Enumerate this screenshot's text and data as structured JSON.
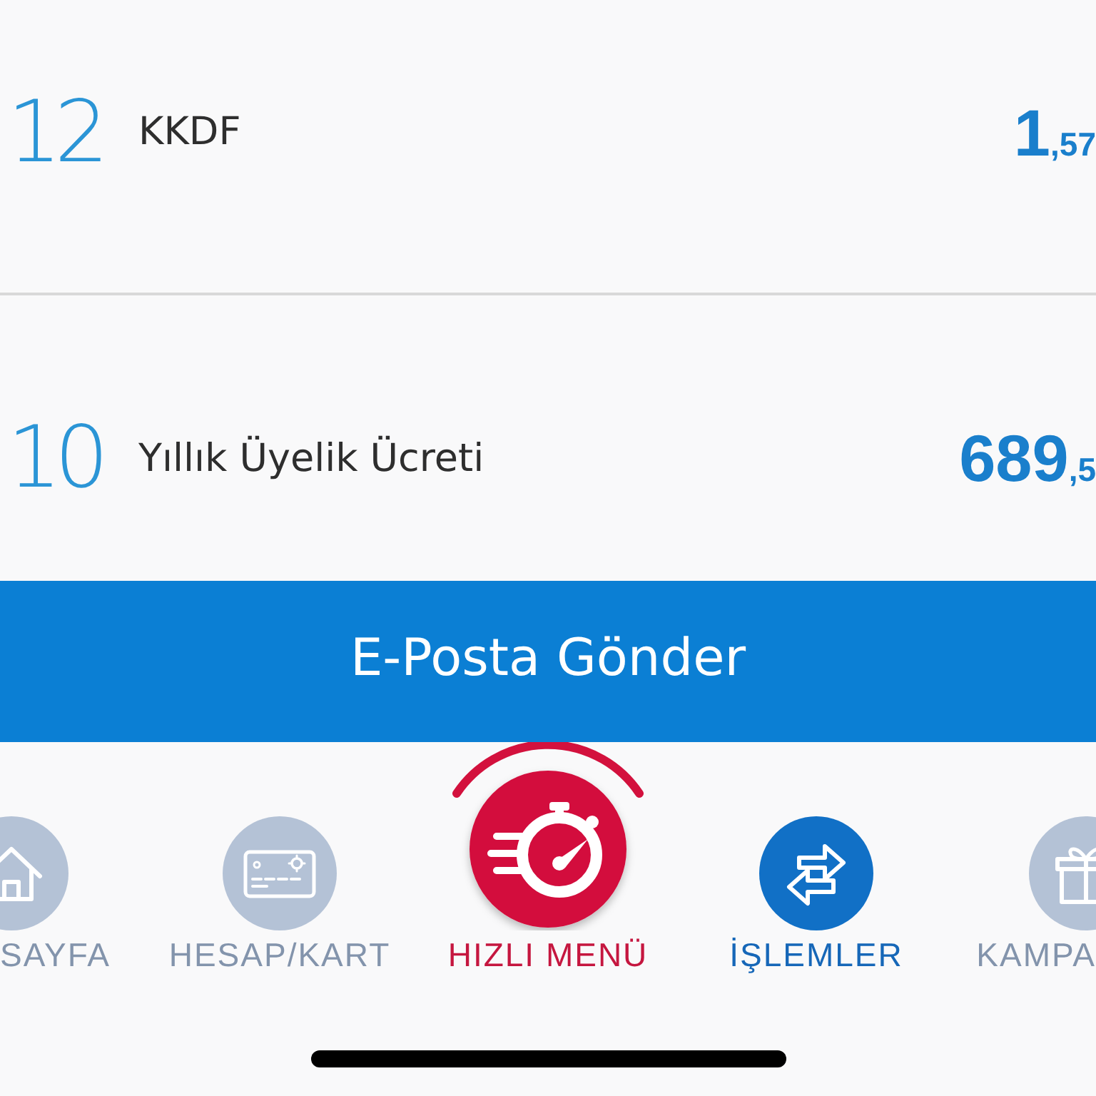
{
  "rows": [
    {
      "number": "12",
      "label": "KKDF",
      "amount": {
        "whole": "1",
        "fraction": ",57"
      }
    },
    {
      "number": "10",
      "label": "Yıllık Üyelik Ücreti",
      "amount": {
        "whole": "689",
        "fraction": ",5"
      }
    }
  ],
  "email_button": {
    "label": "E-Posta Gönder"
  },
  "tab_bar": [
    {
      "kind": "tab",
      "label": "SAYFA",
      "selected": false
    },
    {
      "kind": "tab",
      "label": "HESAP/KART",
      "selected": false
    },
    {
      "kind": "quick",
      "label": "HIZLI MENÜ",
      "selected": false
    },
    {
      "kind": "tab",
      "label": "İŞLEMLER",
      "selected": true
    },
    {
      "kind": "tab",
      "label": "KAMPA",
      "selected": false
    }
  ]
}
